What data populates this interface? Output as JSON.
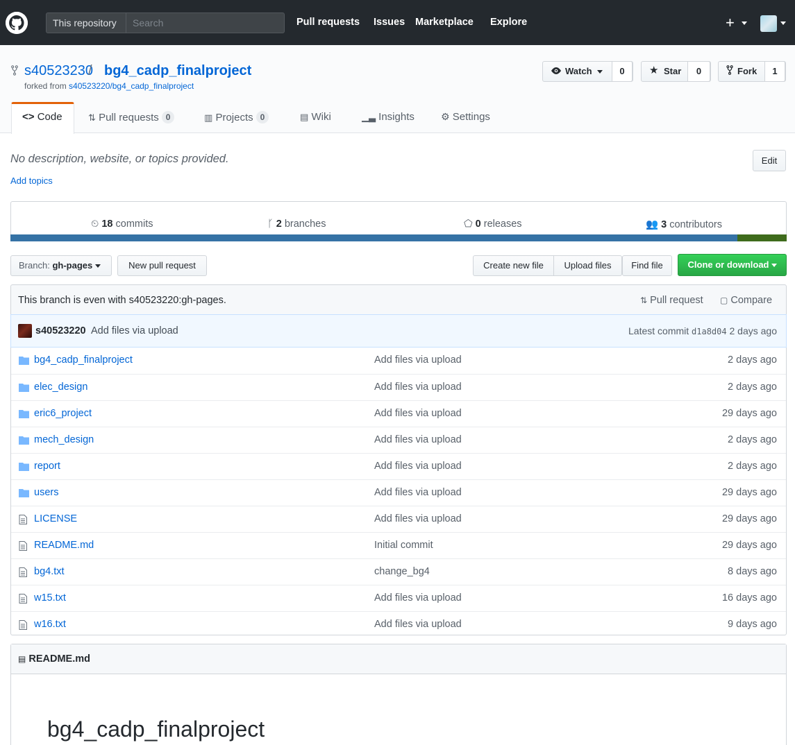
{
  "header": {
    "scope_label": "This repository",
    "search_placeholder": "Search",
    "nav": [
      "Pull requests",
      "Issues",
      "Marketplace",
      "Explore"
    ],
    "plus": "+"
  },
  "repo": {
    "owner": "s40523230",
    "slash": "/",
    "name": "bg4_cadp_finalproject",
    "forked_prefix": "forked from",
    "forked_from": "s40523220/bg4_cadp_finalproject"
  },
  "actions": {
    "watch_label": "Watch",
    "watch_count": "0",
    "star_label": "Star",
    "star_count": "0",
    "fork_label": "Fork",
    "fork_count": "1"
  },
  "tabs": [
    {
      "label": "Code"
    },
    {
      "label": "Pull requests",
      "count": "0"
    },
    {
      "label": "Projects",
      "count": "0"
    },
    {
      "label": "Wiki"
    },
    {
      "label": "Insights"
    },
    {
      "label": "Settings"
    }
  ],
  "about": {
    "description": "No description, website, or topics provided.",
    "add_topics": "Add topics",
    "edit_label": "Edit"
  },
  "summary": {
    "commits_count": "18",
    "commits_label": "commits",
    "branches_count": "2",
    "branches_label": "branches",
    "releases_count": "0",
    "releases_label": "releases",
    "contributors_count": "3",
    "contributors_label": "contributors"
  },
  "language_colors": {
    "primary": "#3572A5",
    "secondary": "#3f6b1c"
  },
  "filenav": {
    "branch_prefix": "Branch:",
    "branch_name": "gh-pages",
    "new_pr": "New pull request",
    "create_file": "Create new file",
    "upload_files": "Upload files",
    "find_file": "Find file",
    "clone": "Clone or download"
  },
  "branch_info": {
    "text": "This branch is even with s40523220:gh-pages.",
    "pull_request": "Pull request",
    "compare": "Compare"
  },
  "latest_commit": {
    "author": "s40523220",
    "message": "Add files via upload",
    "prefix": "Latest commit",
    "sha": "d1a8d04",
    "age": "2 days ago"
  },
  "files": [
    {
      "type": "dir",
      "name": "bg4_cadp_finalproject",
      "message": "Add files via upload",
      "age": "2 days ago"
    },
    {
      "type": "dir",
      "name": "elec_design",
      "message": "Add files via upload",
      "age": "2 days ago"
    },
    {
      "type": "dir",
      "name": "eric6_project",
      "message": "Add files via upload",
      "age": "29 days ago"
    },
    {
      "type": "dir",
      "name": "mech_design",
      "message": "Add files via upload",
      "age": "2 days ago"
    },
    {
      "type": "dir",
      "name": "report",
      "message": "Add files via upload",
      "age": "2 days ago"
    },
    {
      "type": "dir",
      "name": "users",
      "message": "Add files via upload",
      "age": "29 days ago"
    },
    {
      "type": "file",
      "name": "LICENSE",
      "message": "Add files via upload",
      "age": "29 days ago"
    },
    {
      "type": "file",
      "name": "README.md",
      "message": "Initial commit",
      "age": "29 days ago"
    },
    {
      "type": "file",
      "name": "bg4.txt",
      "message": "change_bg4",
      "age": "8 days ago"
    },
    {
      "type": "file",
      "name": "w15.txt",
      "message": "Add files via upload",
      "age": "16 days ago"
    },
    {
      "type": "file",
      "name": "w16.txt",
      "message": "Add files via upload",
      "age": "9 days ago"
    }
  ],
  "readme": {
    "filename": "README.md",
    "heading": "bg4_cadp_finalproject"
  }
}
